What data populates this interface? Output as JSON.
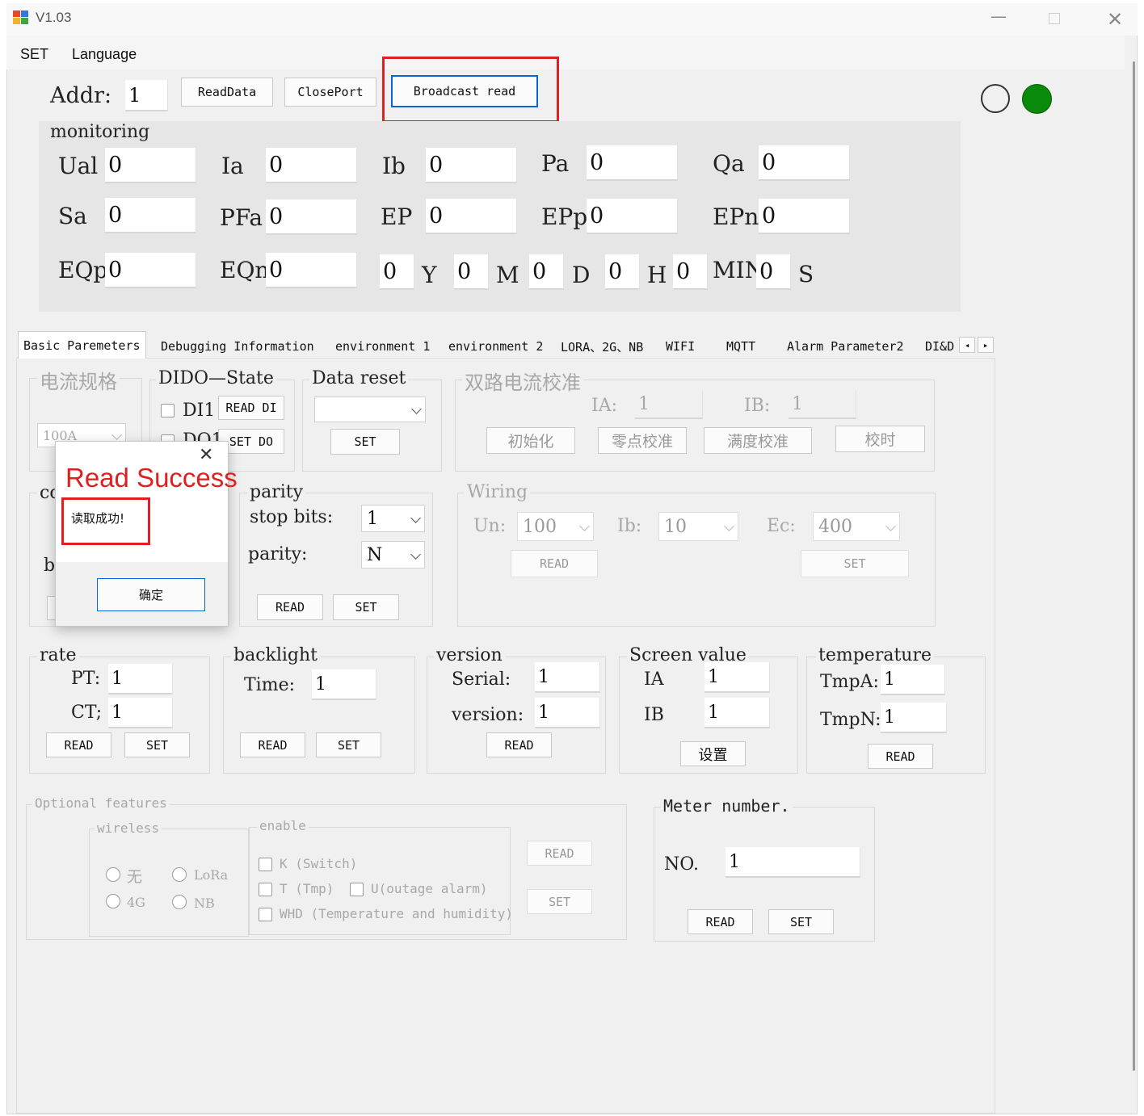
{
  "window": {
    "title": "V1.03"
  },
  "menu": [
    "SET",
    "Language"
  ],
  "toolbar": {
    "addr_label": "Addr:",
    "addr_value": "1",
    "read_data": "ReadData",
    "close_port": "ClosePort",
    "broadcast_read": "Broadcast read"
  },
  "status": {
    "light1_color": "#ffffff",
    "light2_color": "#0a8a0a"
  },
  "monitoring": {
    "title": "monitoring",
    "fields": [
      {
        "label": "Ual",
        "value": "0"
      },
      {
        "label": "Ia",
        "value": "0"
      },
      {
        "label": "Ib",
        "value": "0"
      },
      {
        "label": "Pa",
        "value": "0"
      },
      {
        "label": "Qa",
        "value": "0"
      },
      {
        "label": "Sa",
        "value": "0"
      },
      {
        "label": "PFa",
        "value": "0"
      },
      {
        "label": "EP",
        "value": "0"
      },
      {
        "label": "EPp",
        "value": "0"
      },
      {
        "label": "EPn",
        "value": "0"
      },
      {
        "label": "EQp",
        "value": "0"
      },
      {
        "label": "EQn",
        "value": "0"
      }
    ],
    "datetime": [
      {
        "value": "0",
        "unit": "Y"
      },
      {
        "value": "0",
        "unit": "M"
      },
      {
        "value": "0",
        "unit": "D"
      },
      {
        "value": "0",
        "unit": "H"
      },
      {
        "value": "0",
        "unit": "MIN"
      },
      {
        "value": "0",
        "unit": "S"
      }
    ]
  },
  "tabs": [
    "Basic Paremeters",
    "Debugging Information",
    "environment 1",
    "environment 2",
    "LORA、2G、NB",
    "WIFI",
    "MQTT",
    "Alarm Parameter2",
    "DI&D"
  ],
  "current_spec": {
    "title": "电流规格",
    "value": "100A"
  },
  "dido": {
    "title": "DIDO—State",
    "di1": "DI1",
    "do1": "DO1",
    "read_di": "READ DI",
    "set_do": "SET DO"
  },
  "data_reset": {
    "title": "Data reset",
    "value": "",
    "set": "SET"
  },
  "dual_cal": {
    "title": "双路电流校准",
    "ia_label": "IA:",
    "ia_value": "1",
    "ib_label": "IB:",
    "ib_value": "1",
    "btn_init": "初始化",
    "btn_zero": "零点校准",
    "btn_full": "满度校准",
    "btn_time": "校时"
  },
  "comm": {
    "title_partial": "co",
    "b_partial": "b"
  },
  "parity": {
    "title": "parity",
    "stop_bits_label": "stop bits:",
    "stop_bits_value": "1",
    "parity_label": "parity:",
    "parity_value": "N",
    "read": "READ",
    "set": "SET"
  },
  "wiring": {
    "title": "Wiring",
    "un_label": "Un:",
    "un_value": "100",
    "ib_label": "Ib:",
    "ib_value": "10",
    "ec_label": "Ec:",
    "ec_value": "400",
    "read": "READ",
    "set": "SET"
  },
  "dialog": {
    "title": "Read Success",
    "message": "读取成功!",
    "ok": "确定"
  },
  "rate": {
    "title": "rate",
    "pt_label": "PT:",
    "pt_value": "1",
    "ct_label": "CT;",
    "ct_value": "1",
    "read": "READ",
    "set": "SET"
  },
  "backlight": {
    "title": "backlight",
    "time_label": "Time:",
    "time_value": "1",
    "read": "READ",
    "set": "SET"
  },
  "version": {
    "title": "version",
    "serial_label": "Serial:",
    "serial_value": "1",
    "version_label": "version:",
    "version_value": "1",
    "read": "READ"
  },
  "screen": {
    "title": "Screen value",
    "ia_label": "IA",
    "ia_value": "1",
    "ib_label": "IB",
    "ib_value": "1",
    "set": "设置"
  },
  "temperature": {
    "title": "temperature",
    "tmpa_label": "TmpA:",
    "tmpa_value": "1",
    "tmpn_label": "TmpN:",
    "tmpn_value": "1",
    "read": "READ"
  },
  "optional": {
    "title": "Optional features",
    "wireless_title": "wireless",
    "enable_title": "enable",
    "radios": [
      "无",
      "LoRa",
      "4G",
      "NB"
    ],
    "checks": [
      "K (Switch)",
      "T (Tmp)",
      "U(outage alarm)",
      "WHD (Temperature and humidity)"
    ],
    "read": "READ",
    "set": "SET"
  },
  "meter": {
    "title": "Meter number.",
    "no_label": "NO.",
    "no_value": "1",
    "read": "READ",
    "set": "SET"
  }
}
